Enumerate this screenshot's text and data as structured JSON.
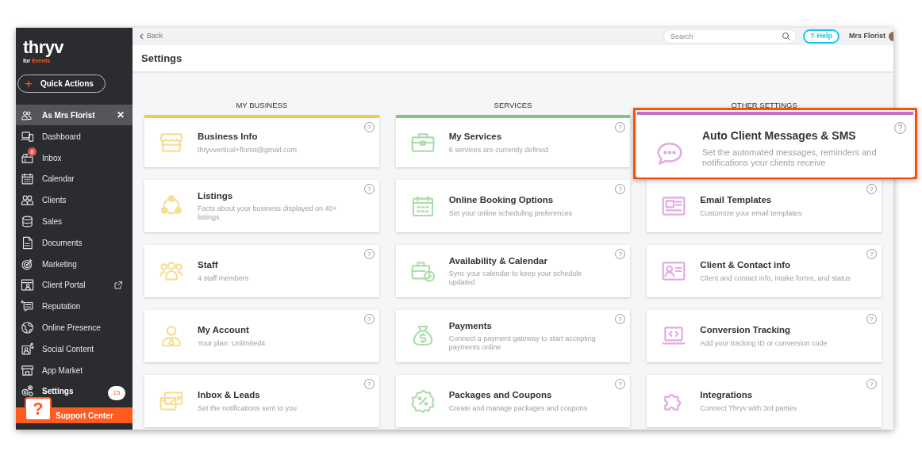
{
  "brand": {
    "name": "thryv",
    "tagline": "for ",
    "tagline_highlight": "Events"
  },
  "quick_actions": {
    "icon_text": "+",
    "label": "Quick Actions"
  },
  "account_switch": {
    "label": "As Mrs Florist",
    "close": "✕"
  },
  "sidebar": {
    "items": [
      {
        "label": "Dashboard",
        "selected": false
      },
      {
        "label": "Inbox",
        "selected": false,
        "badge": "8"
      },
      {
        "label": "Calendar",
        "selected": false
      },
      {
        "label": "Clients",
        "selected": false
      },
      {
        "label": "Sales",
        "selected": false
      },
      {
        "label": "Documents",
        "selected": false
      },
      {
        "label": "Marketing",
        "selected": false
      },
      {
        "label": "Client Portal",
        "selected": false,
        "external": true
      },
      {
        "label": "Reputation",
        "selected": false
      },
      {
        "label": "Online Presence",
        "selected": false
      },
      {
        "label": "Social Content",
        "selected": false
      },
      {
        "label": "App Market",
        "selected": false
      },
      {
        "label": "Settings",
        "selected": true
      }
    ]
  },
  "support": {
    "label": "Support Center",
    "badge": "15",
    "icon_text": "?"
  },
  "top_bar": {
    "back": "Back",
    "search": {
      "placeholder": "Search"
    },
    "help": "Help",
    "help_icon_text": "?",
    "user": "Mrs Florist"
  },
  "page_title": "Settings",
  "sections": [
    {
      "title": "MY BUSINESS",
      "color": "#f2c94c",
      "cards": [
        {
          "title": "Business Info",
          "description": "thryvvertical+florist@gmail.com",
          "highlighted": false
        },
        {
          "title": "Listings",
          "description": "Facts about your business displayed on 40+ listings",
          "highlighted": false
        },
        {
          "title": "Staff",
          "description": "4 staff members",
          "highlighted": false
        },
        {
          "title": "My Account",
          "description": "Your plan: Unlimited4",
          "highlighted": false
        },
        {
          "title": "Inbox & Leads",
          "description": "Set the notifications sent to you",
          "highlighted": false
        }
      ]
    },
    {
      "title": "SERVICES",
      "color": "#7fc882",
      "cards": [
        {
          "title": "My Services",
          "description": "6 services are currently defined",
          "highlighted": false
        },
        {
          "title": "Online Booking Options",
          "description": "Set your online scheduling preferences",
          "highlighted": false
        },
        {
          "title": "Availability & Calendar",
          "description": "Sync your calendar to keep your schedule updated",
          "highlighted": false
        },
        {
          "title": "Payments",
          "description": "Connect a payment gateway to start accepting payments online",
          "highlighted": false
        },
        {
          "title": "Packages and Coupons",
          "description": "Create and manage packages and coupons",
          "highlighted": false
        }
      ]
    },
    {
      "title": "OTHER SETTINGS",
      "color": "#c36fc4",
      "cards": [
        {
          "title": "Auto Client Messages & SMS",
          "description": "Set the automated messages, reminders and notifications your clients receive",
          "highlighted": true
        },
        {
          "title": "Email Templates",
          "description": "Customize your email templates",
          "highlighted": false
        },
        {
          "title": "Client & Contact info",
          "description": "Client and contact info, intake forms, and status",
          "highlighted": false
        },
        {
          "title": "Conversion Tracking",
          "description": "Add your tracking ID or conversion code",
          "highlighted": false
        },
        {
          "title": "Integrations",
          "description": "Connect Thryv with 3rd parties",
          "highlighted": false
        }
      ]
    }
  ],
  "help_mark": "?"
}
